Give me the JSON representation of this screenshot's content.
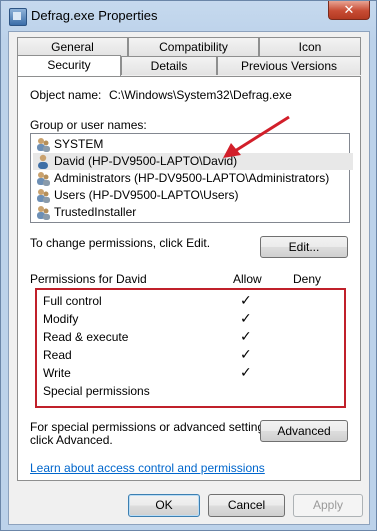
{
  "window": {
    "title": "Defrag.exe Properties",
    "close_label": "✕"
  },
  "tabs": {
    "row1": [
      "General",
      "Compatibility",
      "Icon"
    ],
    "row2": [
      "Security",
      "Details",
      "Previous Versions"
    ]
  },
  "security": {
    "object_name_label": "Object name:",
    "object_name_value": "C:\\Windows\\System32\\Defrag.exe",
    "group_label": "Group or user names:",
    "users": [
      "SYSTEM",
      "David (HP-DV9500-LAPTO\\David)",
      "Administrators (HP-DV9500-LAPTO\\Administrators)",
      "Users (HP-DV9500-LAPTO\\Users)",
      "TrustedInstaller"
    ],
    "change_text": "To change permissions, click Edit.",
    "edit_button": "Edit...",
    "permissions_for": "Permissions for David",
    "allow_header": "Allow",
    "deny_header": "Deny",
    "permissions": [
      {
        "name": "Full control",
        "allow": "✓",
        "deny": ""
      },
      {
        "name": "Modify",
        "allow": "✓",
        "deny": ""
      },
      {
        "name": "Read & execute",
        "allow": "✓",
        "deny": ""
      },
      {
        "name": "Read",
        "allow": "✓",
        "deny": ""
      },
      {
        "name": "Write",
        "allow": "✓",
        "deny": ""
      },
      {
        "name": "Special permissions",
        "allow": "",
        "deny": ""
      }
    ],
    "special_text_line1": "For special permissions or advanced settings,",
    "special_text_line2": "click Advanced.",
    "advanced_button": "Advanced",
    "learn_link": "Learn about access control and permissions"
  },
  "footer": {
    "ok": "OK",
    "cancel": "Cancel",
    "apply": "Apply"
  },
  "colors": {
    "annotation_red": "#d21f2a",
    "link_blue": "#0066cc"
  }
}
